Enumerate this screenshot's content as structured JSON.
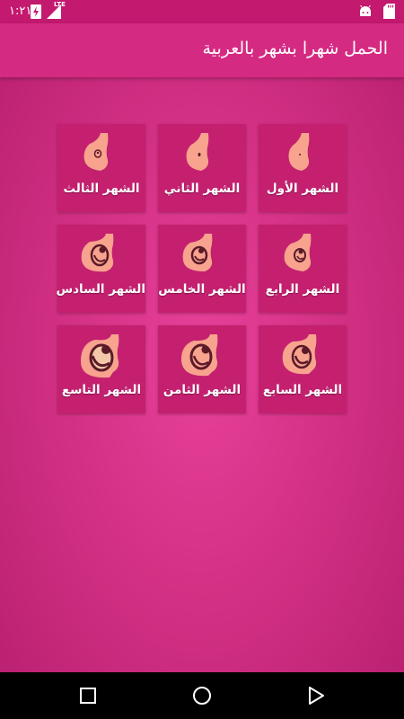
{
  "status_bar": {
    "time": "١:٢١",
    "network": "LTE",
    "icons": [
      "battery-saver-icon",
      "signal-icon",
      "android-icon",
      "sd-card-icon"
    ]
  },
  "app_bar": {
    "title": "الحمل شهرا بشهر بالعربية"
  },
  "months": [
    {
      "label": "الشهر الأول",
      "icon": "belly-month-1-icon"
    },
    {
      "label": "الشهر الثاني",
      "icon": "belly-month-2-icon"
    },
    {
      "label": "الشهر الثالث",
      "icon": "belly-month-3-icon"
    },
    {
      "label": "الشهر الرابع",
      "icon": "belly-month-4-icon"
    },
    {
      "label": "الشهر الخامس",
      "icon": "belly-month-5-icon"
    },
    {
      "label": "الشهر السادس",
      "icon": "belly-month-6-icon"
    },
    {
      "label": "الشهر السابع",
      "icon": "belly-month-7-icon"
    },
    {
      "label": "الشهر الثامن",
      "icon": "belly-month-8-icon"
    },
    {
      "label": "الشهر التاسع",
      "icon": "belly-month-9-icon"
    }
  ],
  "colors": {
    "background": "#d43185",
    "app_bar": "#d52a82",
    "tile": "#c4206f",
    "skin": "#f7a38e",
    "fetus": "#5a1a2a"
  },
  "nav_bar": {
    "icons": [
      "recents-icon",
      "home-icon",
      "back-icon"
    ]
  }
}
